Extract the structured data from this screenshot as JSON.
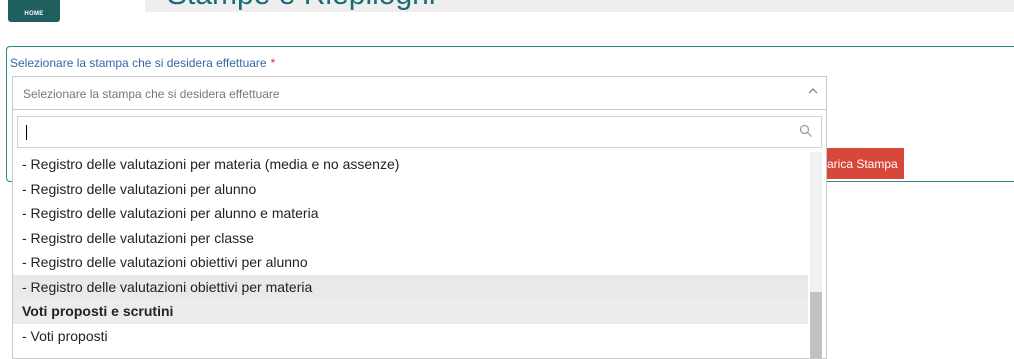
{
  "header": {
    "home_label": "HOME",
    "page_title": "Stampe e Riepiloghi"
  },
  "form": {
    "label": "Selezionare la stampa che si desidera effettuare",
    "required_mark": "*",
    "select_placeholder": "Selezionare la stampa che si desidera effettuare",
    "search_value": "",
    "load_button": "Carica Stampa"
  },
  "dropdown": {
    "options": [
      {
        "label": "- Registro delle valutazioni per materia (media e no assenze)",
        "type": "option",
        "highlighted": false
      },
      {
        "label": "- Registro delle valutazioni per alunno",
        "type": "option",
        "highlighted": false
      },
      {
        "label": "- Registro delle valutazioni per alunno e materia",
        "type": "option",
        "highlighted": false
      },
      {
        "label": "- Registro delle valutazioni per classe",
        "type": "option",
        "highlighted": false
      },
      {
        "label": "- Registro delle valutazioni obiettivi per alunno",
        "type": "option",
        "highlighted": false
      },
      {
        "label": "- Registro delle valutazioni obiettivi per materia",
        "type": "option",
        "highlighted": true
      },
      {
        "label": "Voti proposti e scrutini",
        "type": "group",
        "highlighted": false
      },
      {
        "label": "- Voti proposti",
        "type": "option",
        "highlighted": false
      }
    ]
  },
  "icons": {
    "chevron": "chevron-up-icon",
    "search": "search-icon"
  },
  "colors": {
    "accent": "#2a8a8a",
    "label": "#3566a8",
    "button": "#d7473a",
    "home": "#1f5f5f"
  }
}
